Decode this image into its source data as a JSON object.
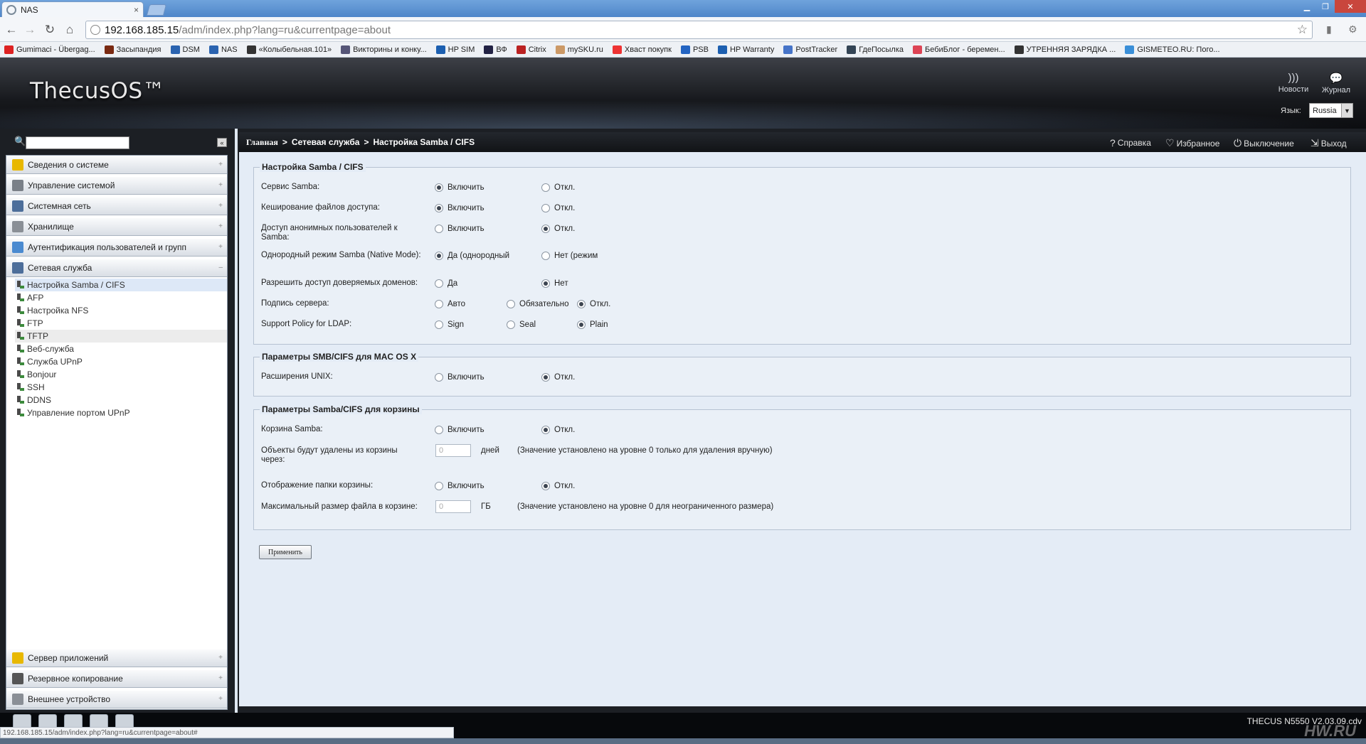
{
  "browser": {
    "tab_title": "NAS",
    "tab_close": "×",
    "url_host": "192.168.185.15",
    "url_path": "/adm/index.php?lang=ru&currentpage=about",
    "bookmarks": [
      {
        "label": "Gumimaci - Übergag...",
        "color": "#d22"
      },
      {
        "label": "Засыпандия",
        "color": "#7a2a12"
      },
      {
        "label": "DSM",
        "color": "#2a63b0"
      },
      {
        "label": "NAS",
        "color": "#2a63b0"
      },
      {
        "label": "«Колыбельная.101»",
        "color": "#333"
      },
      {
        "label": "Викторины и конку...",
        "color": "#557"
      },
      {
        "label": "HP SIM",
        "color": "#1c5fb0"
      },
      {
        "label": "ВФ",
        "color": "#224"
      },
      {
        "label": "Citrix",
        "color": "#b22"
      },
      {
        "label": "mySKU.ru",
        "color": "#c96"
      },
      {
        "label": "Хваст покупк",
        "color": "#e33"
      },
      {
        "label": "PSB",
        "color": "#2364c2"
      },
      {
        "label": "HP Warranty",
        "color": "#1c5fb0"
      },
      {
        "label": "PostTracker",
        "color": "#4674c8"
      },
      {
        "label": "ГдеПосылка",
        "color": "#345"
      },
      {
        "label": "БебиБлог - беремен...",
        "color": "#d45"
      },
      {
        "label": "УТРЕННЯЯ ЗАРЯДКА ...",
        "color": "#333"
      },
      {
        "label": "GISMETEO.RU: Пого...",
        "color": "#3a8fd8"
      }
    ],
    "status_url": "192.168.185.15/adm/index.php?lang=ru&currentpage=about#"
  },
  "header": {
    "logo": "ThecusOS™",
    "news": "Новости",
    "log": "Журнал",
    "lang_label": "Язык:",
    "lang_value": "Russia"
  },
  "sidebar": {
    "groups_top": [
      {
        "label": "Сведения о системе",
        "icon_color": "#e8b800"
      },
      {
        "label": "Управление системой",
        "icon_color": "#7a8088"
      },
      {
        "label": "Системная сеть",
        "icon_color": "#4d6e9a"
      },
      {
        "label": "Хранилище",
        "icon_color": "#8a8f96"
      },
      {
        "label": "Аутентификация пользователей и групп",
        "icon_color": "#4a8ad0"
      },
      {
        "label": "Сетевая служба",
        "icon_color": "#4d6e9a"
      }
    ],
    "sub_items": [
      "Настройка Samba / CIFS",
      "AFP",
      "Настройка NFS",
      "FTP",
      "TFTP",
      "Веб-служба",
      "Служба UPnP",
      "Bonjour",
      "SSH",
      "DDNS",
      "Управление портом UPnP"
    ],
    "groups_bottom": [
      {
        "label": "Сервер приложений",
        "icon_color": "#e8b800"
      },
      {
        "label": "Резервное копирование",
        "icon_color": "#555"
      },
      {
        "label": "Внешнее устройство",
        "icon_color": "#8a8f96"
      }
    ],
    "toggle_open": "–",
    "toggle_closed": "+"
  },
  "breadcrumb": {
    "home": "Главная",
    "section": "Сетевая служба",
    "page": "Настройка Samba / CIFS",
    "separator": ">"
  },
  "actions": {
    "help": "Справка",
    "favorites": "Избранное",
    "shutdown": "Выключение",
    "logout": "Выход"
  },
  "samba": {
    "legend": "Настройка Samba / CIFS",
    "service_label": "Сервис Samba:",
    "cache_label": "Кеширование файлов доступа:",
    "anon_label": "Доступ анонимных пользователей к Samba:",
    "native_label": "Однородный режим Samba (Native Mode):",
    "trusted_label": "Разрешить доступ доверяемых доменов:",
    "signing_label": "Подпись сервера:",
    "ldap_label": "Support Policy for LDAP:",
    "enable": "Включить",
    "disable": "Откл.",
    "native_yes": "Да (однородный",
    "native_no": "Нет (режим",
    "yes": "Да",
    "no": "Нет",
    "auto": "Авто",
    "mandatory": "Обязательно",
    "sign": "Sign",
    "seal": "Seal",
    "plain": "Plain"
  },
  "mac": {
    "legend": "Параметры SMB/CIFS для MAC OS X",
    "unix_label": "Расширения UNIX:",
    "enable": "Включить",
    "disable": "Откл."
  },
  "recycle": {
    "legend": "Параметры Samba/CIFS для корзины",
    "bin_label": "Корзина Samba:",
    "delete_label": "Объекты будут удалены из корзины через:",
    "delete_value": "0",
    "days": "дней",
    "delete_note": "(Значение установлено на уровне 0 только для удаления вручную)",
    "show_label": "Отображение папки корзины:",
    "max_label": "Максимальный размер файла в корзине:",
    "max_value": "0",
    "gb": "ГБ",
    "max_note": "(Значение установлено на уровне 0 для неограниченного размера)",
    "enable": "Включить",
    "disable": "Откл."
  },
  "apply_button": "Применить",
  "footer": {
    "version": "THECUS N5550 V2.03.09.cdv",
    "watermark": "HW.RU"
  }
}
